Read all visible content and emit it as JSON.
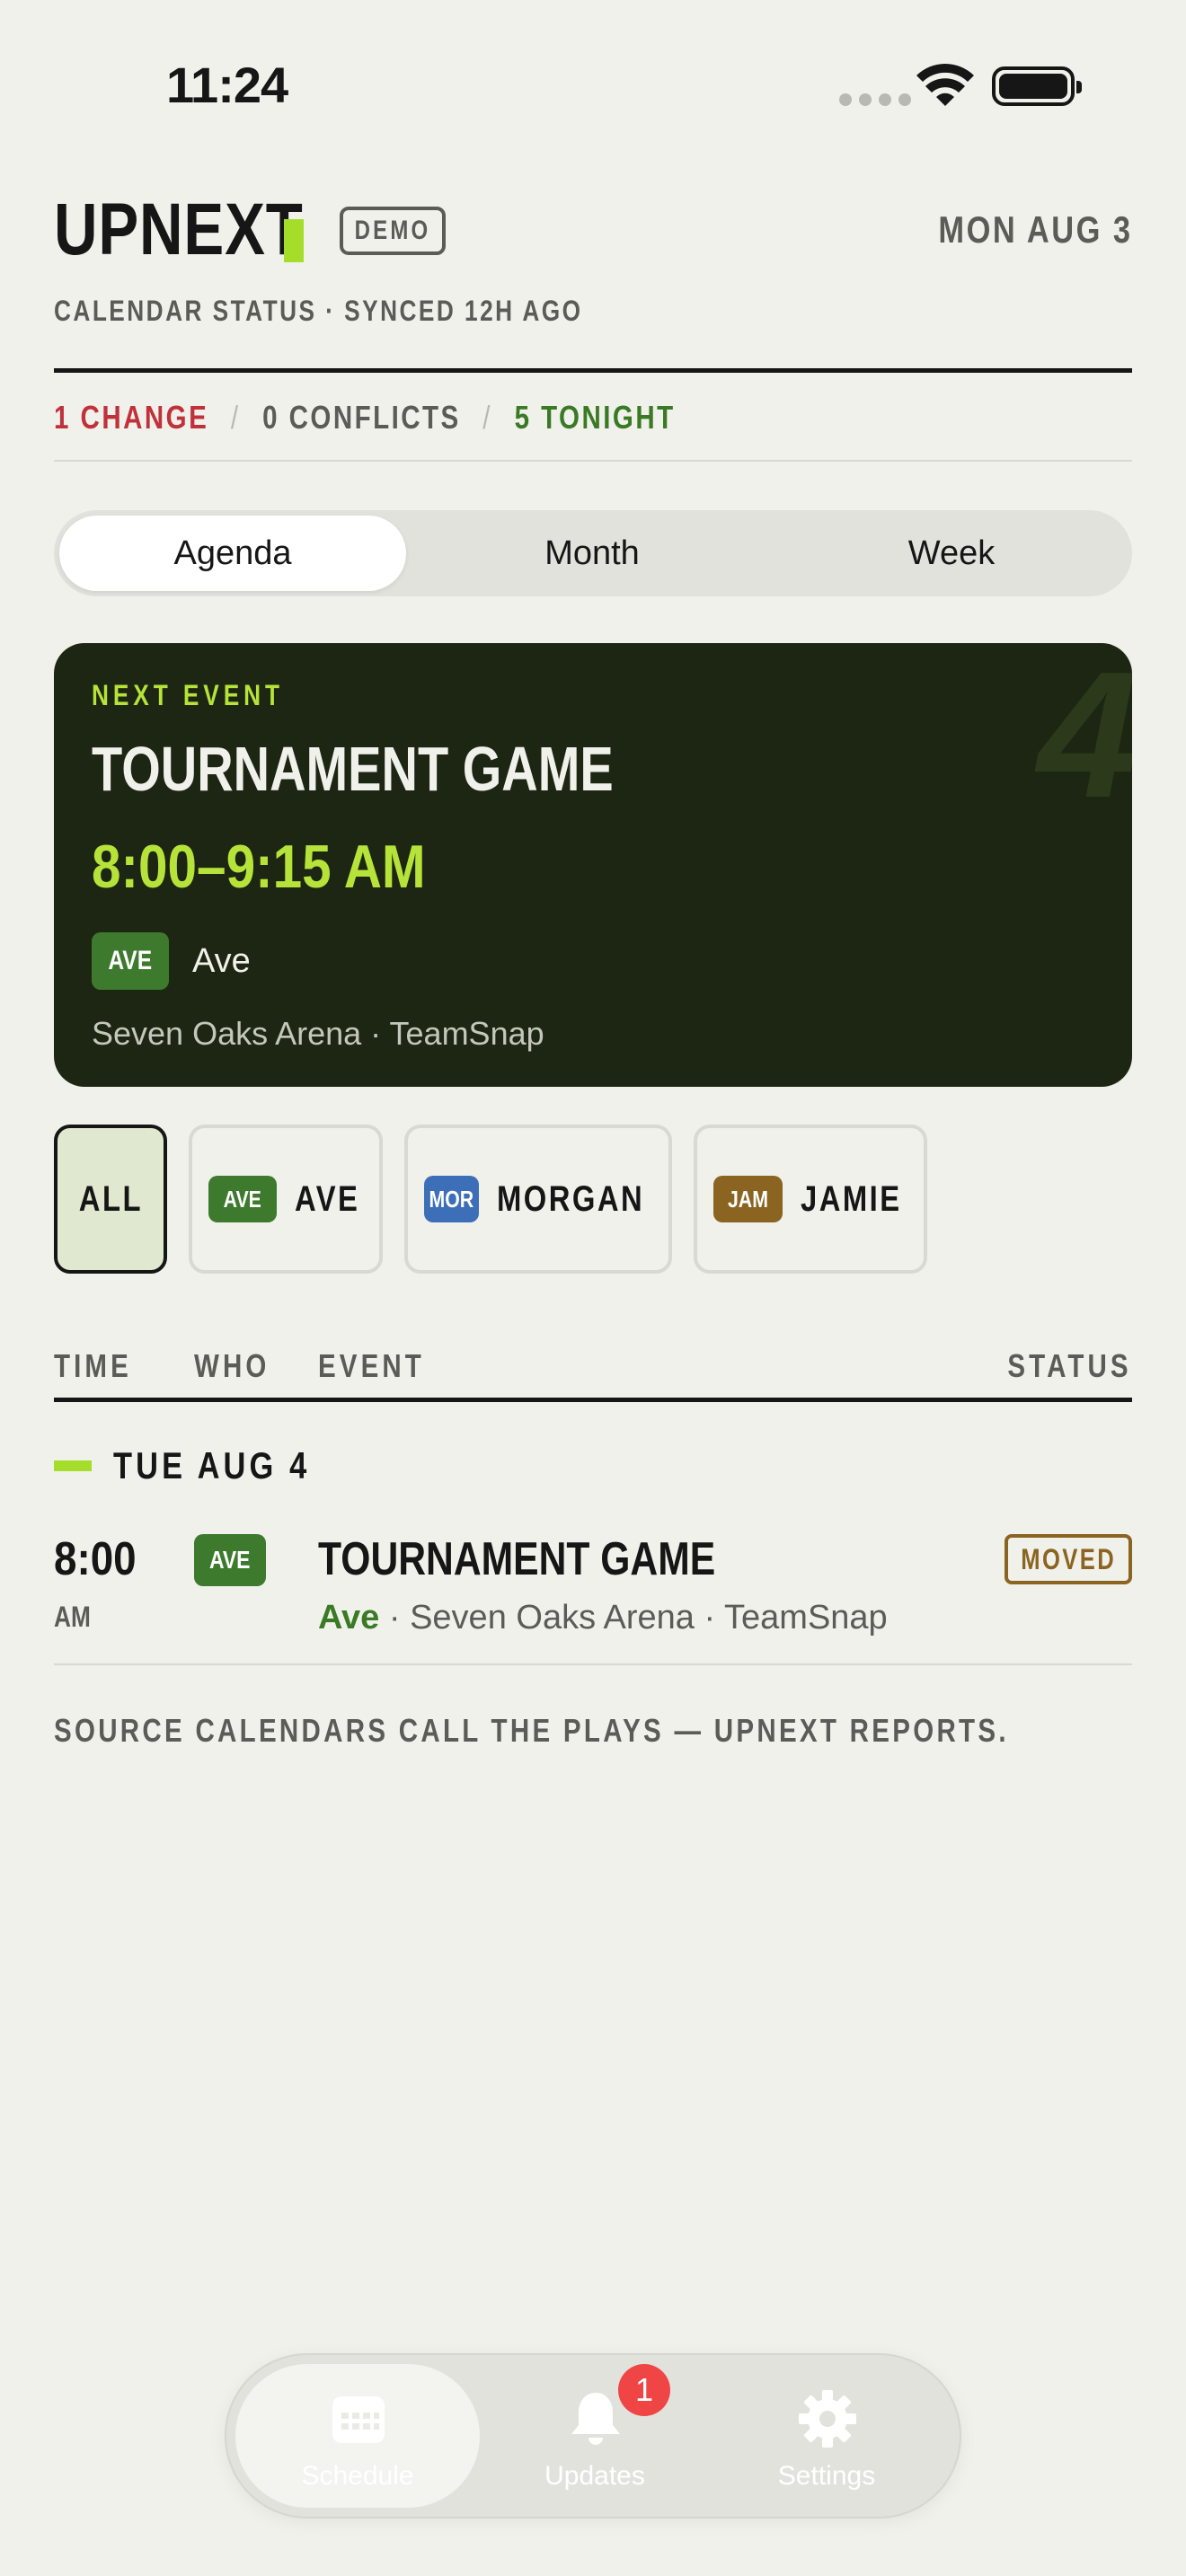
{
  "status_bar": {
    "time": "11:24"
  },
  "header": {
    "app_name": "UPNEXT",
    "demo_badge": "DEMO",
    "date": "MON AUG 3",
    "calendar_status": "CALENDAR STATUS · SYNCED 12H AGO"
  },
  "summary": {
    "changes": "1 CHANGE",
    "conflicts": "0 CONFLICTS",
    "tonight": "5 TONIGHT",
    "separator": "/"
  },
  "view_tabs": [
    {
      "label": "Agenda",
      "active": true
    },
    {
      "label": "Month",
      "active": false
    },
    {
      "label": "Week",
      "active": false
    }
  ],
  "next_event": {
    "label": "NEXT EVENT",
    "title": "TOURNAMENT GAME",
    "time": "8:00–9:15 AM",
    "who_tag": "AVE",
    "who_name": "Ave",
    "location": "Seven Oaks Arena · TeamSnap",
    "big_number": "4"
  },
  "filters": [
    {
      "label": "ALL",
      "tag": "",
      "active": true
    },
    {
      "label": "AVE",
      "tag": "AVE",
      "active": false
    },
    {
      "label": "MORGAN",
      "tag": "MOR",
      "active": false
    },
    {
      "label": "JAMIE",
      "tag": "JAM",
      "active": false
    }
  ],
  "table": {
    "headers": {
      "time": "TIME",
      "who": "WHO",
      "event": "EVENT",
      "status": "STATUS"
    },
    "day": "TUE AUG 4",
    "rows": [
      {
        "time": "8:00",
        "ampm": "AM",
        "who_tag": "AVE",
        "title": "TOURNAMENT GAME",
        "who_name": "Ave",
        "meta": " · Seven Oaks Arena · TeamSnap",
        "status": "MOVED"
      }
    ]
  },
  "footer_note": "SOURCE CALENDARS CALL THE PLAYS — UPNEXT REPORTS.",
  "tab_bar": {
    "items": [
      {
        "label": "Schedule",
        "icon": "calendar-icon",
        "active": true
      },
      {
        "label": "Updates",
        "icon": "bell-icon",
        "active": false,
        "badge": "1"
      },
      {
        "label": "Settings",
        "icon": "gear-icon",
        "active": false
      }
    ]
  },
  "colors": {
    "background": "#f1f1ec",
    "accent_lime": "#a4de2a",
    "card_dark": "#1d2612",
    "change_red": "#c0313a",
    "tonight_green": "#3a7a25",
    "tag_ave": "#3d7a2d",
    "tag_mor": "#3d6fb8",
    "tag_jam": "#8a6420",
    "badge_red": "#f04545"
  }
}
